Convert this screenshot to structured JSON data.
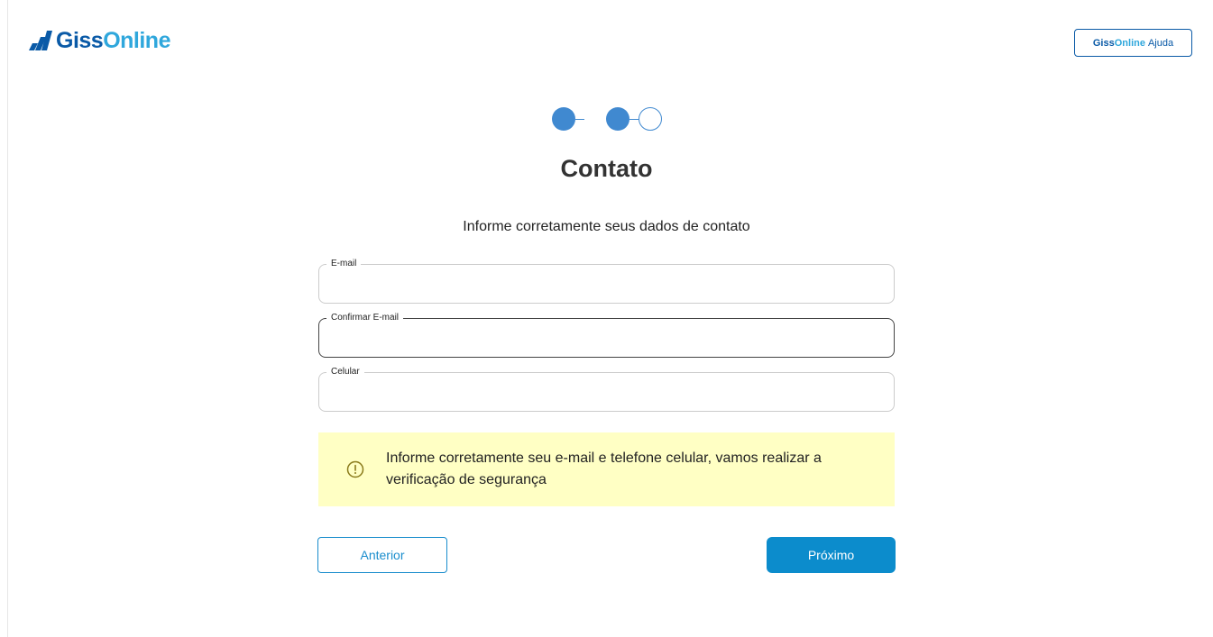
{
  "header": {
    "logo": {
      "part1": "Giss",
      "part2": "Online"
    },
    "help_button": {
      "part1": "Giss",
      "part2": "Online",
      "part3": "Ajuda"
    }
  },
  "stepper": {
    "total_steps": 3,
    "completed_steps": 2
  },
  "page": {
    "title": "Contato",
    "subtitle": "Informe corretamente seus dados de contato"
  },
  "form": {
    "email": {
      "label": "E-mail",
      "value": ""
    },
    "confirm_email": {
      "label": "Confirmar E-mail",
      "value": ""
    },
    "phone": {
      "label": "Celular",
      "value": ""
    }
  },
  "alert": {
    "icon": "alert-circle-icon",
    "text": "Informe corretamente seu e-mail e telefone celular, vamos realizar a verificação de segurança"
  },
  "buttons": {
    "previous": "Anterior",
    "next": "Próximo"
  },
  "colors": {
    "brand_dark": "#0a5aa7",
    "brand_light": "#2fa7dc",
    "step_active": "#4089d0",
    "primary_button": "#0c8ccc",
    "alert_background": "#ffffc4"
  }
}
